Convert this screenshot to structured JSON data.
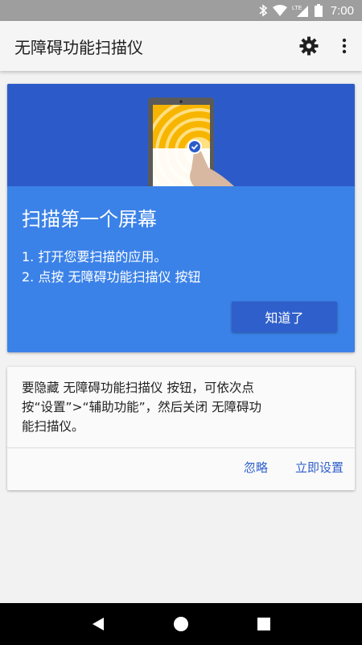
{
  "status_bar": {
    "time": "7:00",
    "network_label": "LTE"
  },
  "app_bar": {
    "title": "无障碍功能扫描仪",
    "settings_icon": "gear-icon",
    "more_icon": "more-vert-icon"
  },
  "intro_card": {
    "title": "扫描第一个屏幕",
    "steps": [
      "1. 打开您要扫描的应用。",
      "2. 点按 无障碍功能扫描仪 按钮"
    ],
    "ok_label": "知道了"
  },
  "notice_card": {
    "text": "要隐藏 无障碍功能扫描仪 按钮，可依次点按“设置”>“辅助功能”，然后关闭 无障碍功能扫描仪。",
    "ignore_label": "忽略",
    "settings_label": "立即设置"
  },
  "colors": {
    "status_bar": "#9e9e9e",
    "card_blue": "#3b82e8",
    "hero_blue": "#2c5bc9",
    "button_blue": "#2f5fcb",
    "phone_yellow": "#f7b500"
  }
}
